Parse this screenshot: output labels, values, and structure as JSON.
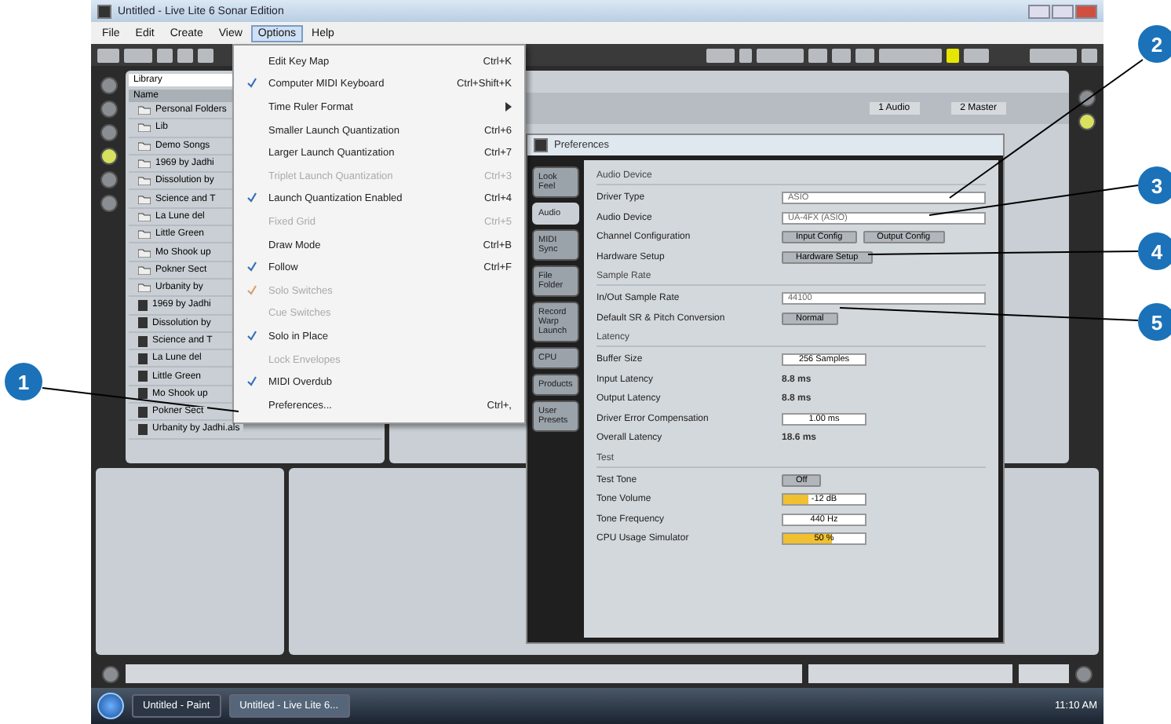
{
  "window": {
    "title": "Untitled - Live Lite 6 Sonar Edition"
  },
  "menu_bar": [
    {
      "label": "File",
      "selected": false
    },
    {
      "label": "Edit",
      "selected": false
    },
    {
      "label": "Create",
      "selected": false
    },
    {
      "label": "View",
      "selected": false
    },
    {
      "label": "Options",
      "selected": true
    },
    {
      "label": "Help",
      "selected": false
    }
  ],
  "options_menu": [
    {
      "kind": "item",
      "label": "Edit Key Map",
      "shortcut": "Ctrl+K",
      "checked": false,
      "disabled": false
    },
    {
      "kind": "item",
      "label": "Computer MIDI Keyboard",
      "shortcut": "Ctrl+Shift+K",
      "checked": true,
      "disabled": false
    },
    {
      "kind": "submenu",
      "label": "Time Ruler Format",
      "checked": false,
      "disabled": false
    },
    {
      "kind": "item",
      "label": "Smaller Launch Quantization",
      "shortcut": "Ctrl+6",
      "checked": false,
      "disabled": false
    },
    {
      "kind": "item",
      "label": "Larger Launch Quantization",
      "shortcut": "Ctrl+7",
      "checked": false,
      "disabled": false
    },
    {
      "kind": "item",
      "label": "Triplet Launch Quantization",
      "shortcut": "Ctrl+3",
      "checked": false,
      "disabled": true
    },
    {
      "kind": "item",
      "label": "Launch Quantization Enabled",
      "shortcut": "Ctrl+4",
      "checked": true,
      "disabled": false
    },
    {
      "kind": "item",
      "label": "Fixed Grid",
      "shortcut": "Ctrl+5",
      "checked": false,
      "disabled": true
    },
    {
      "kind": "item",
      "label": "Draw Mode",
      "shortcut": "Ctrl+B",
      "checked": false,
      "disabled": false
    },
    {
      "kind": "item",
      "label": "Follow",
      "shortcut": "Ctrl+F",
      "checked": true,
      "disabled": false
    },
    {
      "kind": "item",
      "label": "Solo Switches",
      "checked": true,
      "disabled": true
    },
    {
      "kind": "item",
      "label": "Cue Switches",
      "checked": false,
      "disabled": true
    },
    {
      "kind": "item",
      "label": "Solo in Place",
      "checked": true,
      "disabled": false
    },
    {
      "kind": "item",
      "label": "Lock Envelopes",
      "checked": false,
      "disabled": true
    },
    {
      "kind": "item",
      "label": "MIDI Overdub",
      "checked": true,
      "disabled": false
    },
    {
      "kind": "item",
      "label": "Preferences...",
      "shortcut": "Ctrl+,",
      "checked": false,
      "disabled": false
    }
  ],
  "browser": {
    "location": "Library",
    "header": "Name",
    "items": [
      {
        "kind": "folder",
        "label": "Personal Folders"
      },
      {
        "kind": "folder",
        "label": "Lib"
      },
      {
        "kind": "folder",
        "label": "Demo Songs"
      },
      {
        "kind": "folder",
        "label": "1969 by Jadhi"
      },
      {
        "kind": "folder",
        "label": "Dissolution by"
      },
      {
        "kind": "folder",
        "label": "Science and T"
      },
      {
        "kind": "folder",
        "label": "La Lune del"
      },
      {
        "kind": "folder",
        "label": "Little Green"
      },
      {
        "kind": "folder",
        "label": "Mo Shook up"
      },
      {
        "kind": "folder",
        "label": "Pokner Sect"
      },
      {
        "kind": "folder",
        "label": "Urbanity by"
      },
      {
        "kind": "file",
        "label": "1969 by Jadhi"
      },
      {
        "kind": "file",
        "label": "Dissolution by"
      },
      {
        "kind": "file",
        "label": "Science and T"
      },
      {
        "kind": "file",
        "label": "La Lune del"
      },
      {
        "kind": "file",
        "label": "Little Green"
      },
      {
        "kind": "file",
        "label": "Mo Shook up"
      },
      {
        "kind": "file",
        "label": "Pokner Sect"
      },
      {
        "kind": "file",
        "label": "Urbanity by Jadhi.als"
      }
    ]
  },
  "session": {
    "columns": [
      "1 Audio",
      "2 Master"
    ]
  },
  "preferences": {
    "title": "Preferences",
    "tabs": [
      {
        "label": "Look Feel",
        "selected": false
      },
      {
        "label": "Audio",
        "selected": true
      },
      {
        "label": "MIDI Sync",
        "selected": false
      },
      {
        "label": "File Folder",
        "selected": false
      },
      {
        "label": "Record Warp Launch",
        "selected": false
      },
      {
        "label": "CPU",
        "selected": false
      },
      {
        "label": "Products",
        "selected": false
      },
      {
        "label": "User Presets",
        "selected": false
      }
    ],
    "sections": [
      {
        "heading": "Audio Device",
        "rows": [
          {
            "kind": "dropdown",
            "label": "Driver Type",
            "value": "ASIO"
          },
          {
            "kind": "dropdown",
            "label": "Audio Device",
            "value": "UA-4FX (ASIO)"
          },
          {
            "kind": "buttons",
            "label": "Channel Configuration",
            "buttons": [
              "Input Config",
              "Output Config"
            ]
          },
          {
            "kind": "buttons",
            "label": "Hardware Setup",
            "buttons": [
              "Hardware Setup"
            ]
          }
        ]
      },
      {
        "heading": "Sample Rate",
        "rows": [
          {
            "kind": "dropdown",
            "label": "In/Out Sample Rate",
            "value": "44100"
          },
          {
            "kind": "buttons",
            "label": "Default SR & Pitch Conversion",
            "buttons": [
              "Normal"
            ]
          }
        ]
      },
      {
        "heading": "Latency",
        "rows": [
          {
            "kind": "field",
            "label": "Buffer Size",
            "value": "256 Samples"
          },
          {
            "kind": "text",
            "label": "Input Latency",
            "value": "8.8 ms"
          },
          {
            "kind": "text",
            "label": "Output Latency",
            "value": "8.8 ms"
          },
          {
            "kind": "field",
            "label": "Driver Error Compensation",
            "value": "1.00 ms"
          },
          {
            "kind": "text",
            "label": "Overall Latency",
            "value": "18.6 ms"
          }
        ]
      },
      {
        "heading": "Test",
        "rows": [
          {
            "kind": "buttons",
            "label": "Test Tone",
            "buttons": [
              "Off"
            ]
          },
          {
            "kind": "slider",
            "label": "Tone Volume",
            "value": "-12 dB",
            "level": 0.3
          },
          {
            "kind": "field",
            "label": "Tone Frequency",
            "value": "440 Hz"
          },
          {
            "kind": "slider",
            "label": "CPU Usage Simulator",
            "value": "50 %",
            "level": 0.6
          }
        ]
      }
    ]
  },
  "taskbar": {
    "tasks": [
      {
        "label": "Untitled - Paint",
        "selected": false
      },
      {
        "label": "Untitled - Live Lite 6...",
        "selected": true
      }
    ],
    "clock": "11:10 AM"
  },
  "callouts": [
    "1",
    "2",
    "3",
    "4",
    "5"
  ]
}
